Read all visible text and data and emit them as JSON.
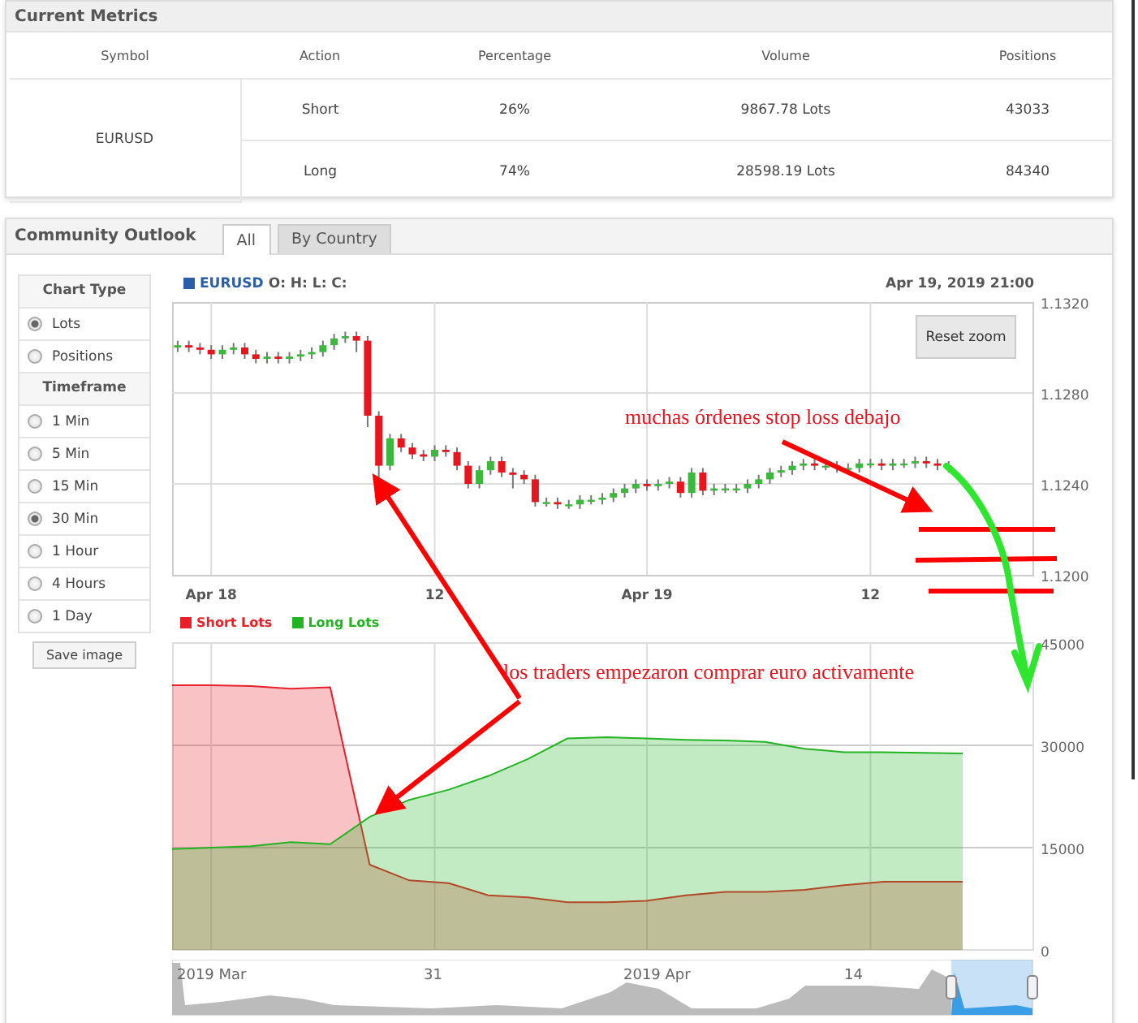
{
  "metrics": {
    "title": "Current Metrics",
    "columns": [
      "Symbol",
      "Action",
      "Percentage",
      "Volume",
      "Positions"
    ],
    "symbol": "EURUSD",
    "rows": [
      {
        "action": "Short",
        "percentage": "26%",
        "volume": "9867.78 Lots",
        "positions": "43033"
      },
      {
        "action": "Long",
        "percentage": "74%",
        "volume": "28598.19 Lots",
        "positions": "84340"
      }
    ]
  },
  "outlook": {
    "title": "Community Outlook",
    "tabs": [
      {
        "label": "All",
        "selected": true
      },
      {
        "label": "By Country",
        "selected": false
      }
    ],
    "sidebar": {
      "groups": [
        {
          "title": "Chart Type",
          "options": [
            {
              "label": "Lots",
              "selected": true
            },
            {
              "label": "Positions",
              "selected": false
            }
          ]
        },
        {
          "title": "Timeframe",
          "options": [
            {
              "label": "1 Min",
              "selected": false
            },
            {
              "label": "5 Min",
              "selected": false
            },
            {
              "label": "15 Min",
              "selected": false
            },
            {
              "label": "30 Min",
              "selected": true
            },
            {
              "label": "1 Hour",
              "selected": false
            },
            {
              "label": "4 Hours",
              "selected": false
            },
            {
              "label": "1 Day",
              "selected": false
            }
          ]
        }
      ],
      "save_button": "Save image"
    },
    "price_chart": {
      "symbol": "EURUSD",
      "ohlc_label": "O: H: L: C:",
      "date": "Apr 19, 2019 21:00",
      "reset_button": "Reset zoom",
      "chart_data": {
        "type": "candlestick",
        "grid": true,
        "ylim": [
          1.12,
          1.132
        ],
        "categories": [
          null,
          null,
          null,
          "Apr 18",
          null,
          null,
          null,
          null,
          null,
          null,
          null,
          null,
          null,
          null,
          null,
          null,
          null,
          null,
          null,
          null,
          null,
          null,
          null,
          "12",
          null,
          null,
          null,
          null,
          null,
          null,
          null,
          null,
          null,
          null,
          null,
          null,
          null,
          null,
          null,
          null,
          null,
          null,
          "Apr 19",
          null,
          null,
          null,
          null,
          null,
          null,
          null,
          null,
          null,
          null,
          null,
          null,
          null,
          null,
          null,
          null,
          null,
          null,
          null,
          "12",
          null,
          null,
          null,
          null,
          null,
          null,
          null,
          null,
          null,
          null,
          null,
          null,
          null,
          null
        ],
        "yticks": [
          {
            "value": 1.132,
            "label": "1.1320"
          },
          {
            "value": 1.128,
            "label": "1.1280"
          },
          {
            "value": 1.124,
            "label": "1.1240"
          },
          {
            "value": 1.12,
            "label": "1.1200"
          }
        ],
        "ohlc": [
          [
            1.13,
            1.1303,
            1.1298,
            1.1301
          ],
          [
            1.1301,
            1.1303,
            1.1298,
            1.13
          ],
          [
            1.13,
            1.1302,
            1.1297,
            1.1299
          ],
          [
            1.1299,
            1.1301,
            1.1295,
            1.1297
          ],
          [
            1.1297,
            1.1301,
            1.1295,
            1.1299
          ],
          [
            1.1299,
            1.1302,
            1.1297,
            1.13
          ],
          [
            1.13,
            1.1302,
            1.1295,
            1.1297
          ],
          [
            1.1297,
            1.1299,
            1.1293,
            1.1295
          ],
          [
            1.1295,
            1.1298,
            1.1293,
            1.1296
          ],
          [
            1.1296,
            1.1298,
            1.1293,
            1.1295
          ],
          [
            1.1295,
            1.1298,
            1.1293,
            1.1296
          ],
          [
            1.1296,
            1.1299,
            1.1294,
            1.1297
          ],
          [
            1.1297,
            1.13,
            1.1295,
            1.1298
          ],
          [
            1.1298,
            1.1303,
            1.1296,
            1.1301
          ],
          [
            1.1301,
            1.1306,
            1.1299,
            1.1304
          ],
          [
            1.1304,
            1.1307,
            1.1302,
            1.1305
          ],
          [
            1.1305,
            1.1307,
            1.1298,
            1.1303
          ],
          [
            1.1303,
            1.1305,
            1.1265,
            1.127
          ],
          [
            1.127,
            1.1272,
            1.1242,
            1.1248
          ],
          [
            1.1248,
            1.1262,
            1.1246,
            1.126
          ],
          [
            1.126,
            1.1262,
            1.1254,
            1.1256
          ],
          [
            1.1256,
            1.1258,
            1.1251,
            1.1253
          ],
          [
            1.1253,
            1.1255,
            1.125,
            1.1252
          ],
          [
            1.1252,
            1.1257,
            1.125,
            1.1255
          ],
          [
            1.1255,
            1.1257,
            1.1252,
            1.1254
          ],
          [
            1.1254,
            1.1256,
            1.1246,
            1.1248
          ],
          [
            1.1248,
            1.125,
            1.1238,
            1.124
          ],
          [
            1.124,
            1.1248,
            1.1238,
            1.1246
          ],
          [
            1.1246,
            1.1252,
            1.1244,
            1.125
          ],
          [
            1.125,
            1.1252,
            1.1243,
            1.1245
          ],
          [
            1.1245,
            1.1247,
            1.1238,
            1.1244
          ],
          [
            1.1244,
            1.1246,
            1.124,
            1.1242
          ],
          [
            1.1242,
            1.1244,
            1.123,
            1.1232
          ],
          [
            1.1232,
            1.1234,
            1.123,
            1.1232
          ],
          [
            1.1232,
            1.1234,
            1.1229,
            1.1231
          ],
          [
            1.1231,
            1.1233,
            1.1229,
            1.1231
          ],
          [
            1.1231,
            1.1235,
            1.1229,
            1.1233
          ],
          [
            1.1233,
            1.1235,
            1.1231,
            1.1233
          ],
          [
            1.1233,
            1.1236,
            1.1231,
            1.1234
          ],
          [
            1.1234,
            1.1238,
            1.1232,
            1.1236
          ],
          [
            1.1236,
            1.124,
            1.1234,
            1.1238
          ],
          [
            1.1238,
            1.1242,
            1.1236,
            1.124
          ],
          [
            1.124,
            1.1242,
            1.1237,
            1.1239
          ],
          [
            1.1239,
            1.1242,
            1.1237,
            1.124
          ],
          [
            1.124,
            1.1243,
            1.1238,
            1.1241
          ],
          [
            1.1241,
            1.1243,
            1.1234,
            1.1236
          ],
          [
            1.1236,
            1.1247,
            1.1234,
            1.1245
          ],
          [
            1.1245,
            1.1247,
            1.1235,
            1.1237
          ],
          [
            1.1237,
            1.124,
            1.1235,
            1.1238
          ],
          [
            1.1238,
            1.124,
            1.1236,
            1.1238
          ],
          [
            1.1238,
            1.124,
            1.1236,
            1.1238
          ],
          [
            1.1238,
            1.1242,
            1.1236,
            1.124
          ],
          [
            1.124,
            1.1244,
            1.1238,
            1.1242
          ],
          [
            1.1242,
            1.1247,
            1.124,
            1.1245
          ],
          [
            1.1245,
            1.1248,
            1.1243,
            1.1246
          ],
          [
            1.1246,
            1.125,
            1.1244,
            1.1248
          ],
          [
            1.1248,
            1.1251,
            1.1246,
            1.1249
          ],
          [
            1.1249,
            1.1251,
            1.1246,
            1.1248
          ],
          [
            1.1248,
            1.125,
            1.1246,
            1.1248
          ],
          [
            1.1248,
            1.125,
            1.1245,
            1.1247
          ],
          [
            1.1247,
            1.1249,
            1.1245,
            1.1247
          ],
          [
            1.1247,
            1.1251,
            1.1245,
            1.1249
          ],
          [
            1.1249,
            1.1251,
            1.1247,
            1.1249
          ],
          [
            1.1249,
            1.1251,
            1.1246,
            1.1248
          ],
          [
            1.1248,
            1.1251,
            1.1246,
            1.1249
          ],
          [
            1.1249,
            1.1251,
            1.1247,
            1.1249
          ],
          [
            1.1249,
            1.1252,
            1.1247,
            1.125
          ],
          [
            1.125,
            1.1252,
            1.1247,
            1.1249
          ],
          [
            1.1249,
            1.1251,
            1.1246,
            1.1248
          ],
          [
            1.1248,
            1.125,
            1.1245,
            1.1247
          ],
          null,
          null,
          null,
          null,
          null,
          null,
          null
        ]
      }
    },
    "lots_chart": {
      "chart_data": {
        "type": "area",
        "grid": true,
        "ylim": [
          0,
          45000
        ],
        "yticks": [
          0,
          15000,
          30000,
          45000
        ],
        "series": [
          {
            "name": "Short Lots",
            "color": "#e8202a",
            "values": [
              38800,
              38800,
              38700,
              38300,
              38500,
              12500,
              10200,
              9800,
              8000,
              7700,
              7000,
              7000,
              7200,
              8000,
              8500,
              8500,
              8800,
              9500,
              10000,
              10000,
              10000
            ]
          },
          {
            "name": "Long Lots",
            "color": "#22b422",
            "values": [
              14800,
              15000,
              15200,
              15800,
              15500,
              19500,
              22000,
              23500,
              25500,
              28000,
              31000,
              31200,
              31000,
              30800,
              30700,
              30500,
              29500,
              29000,
              29000,
              28900,
              28800
            ]
          }
        ]
      }
    },
    "navigator": {
      "labels": [
        "2019 Mar",
        "31",
        "2019 Apr",
        "14"
      ]
    }
  },
  "annotations": [
    {
      "text": "muchas órdenes stop loss debajo"
    },
    {
      "text": "los traders empezaron comprar euro activamente"
    }
  ]
}
